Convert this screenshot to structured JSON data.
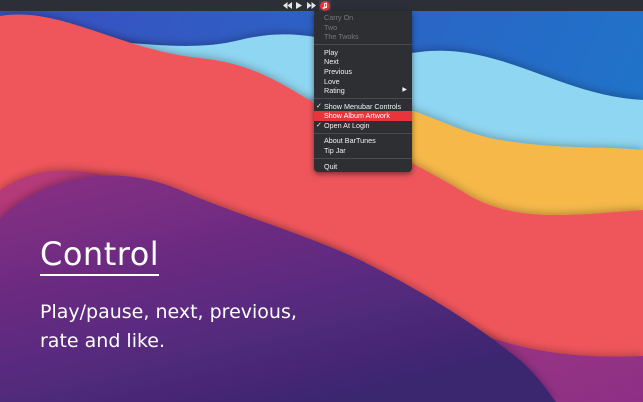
{
  "menubar": {
    "controls": [
      {
        "icon": "rewind-icon"
      },
      {
        "icon": "play-icon"
      },
      {
        "icon": "fast-forward-icon"
      }
    ],
    "app_icon": "music-note-icon",
    "app_icon_color": "#e8353b"
  },
  "menu": {
    "now_playing": {
      "track": "Carry On",
      "album": "Two",
      "artist": "The Twoks"
    },
    "playback": {
      "play": "Play",
      "next": "Next",
      "previous": "Previous",
      "love": "Love",
      "rating": "Rating"
    },
    "options": {
      "show_menubar_controls": "Show Menubar Controls",
      "show_album_artwork": "Show Album Artwork",
      "open_at_login": "Open At Login"
    },
    "check_glyph": "✓",
    "submenu_arrow": "▶",
    "info": {
      "about": "About BarTunes",
      "tip_jar": "Tip Jar"
    },
    "quit": "Quit",
    "highlight_color": "#e8353b"
  },
  "feature": {
    "title": "Control",
    "description": "Play/pause, next, previous, rate and like."
  },
  "wallpaper_colors": {
    "top_blue": "#2a6fd0",
    "light_blue": "#8fd3f0",
    "yellow": "#f5b94a",
    "coral": "#ef5a5f",
    "magenta": "#a2337e",
    "purple": "#4a2a7c"
  }
}
